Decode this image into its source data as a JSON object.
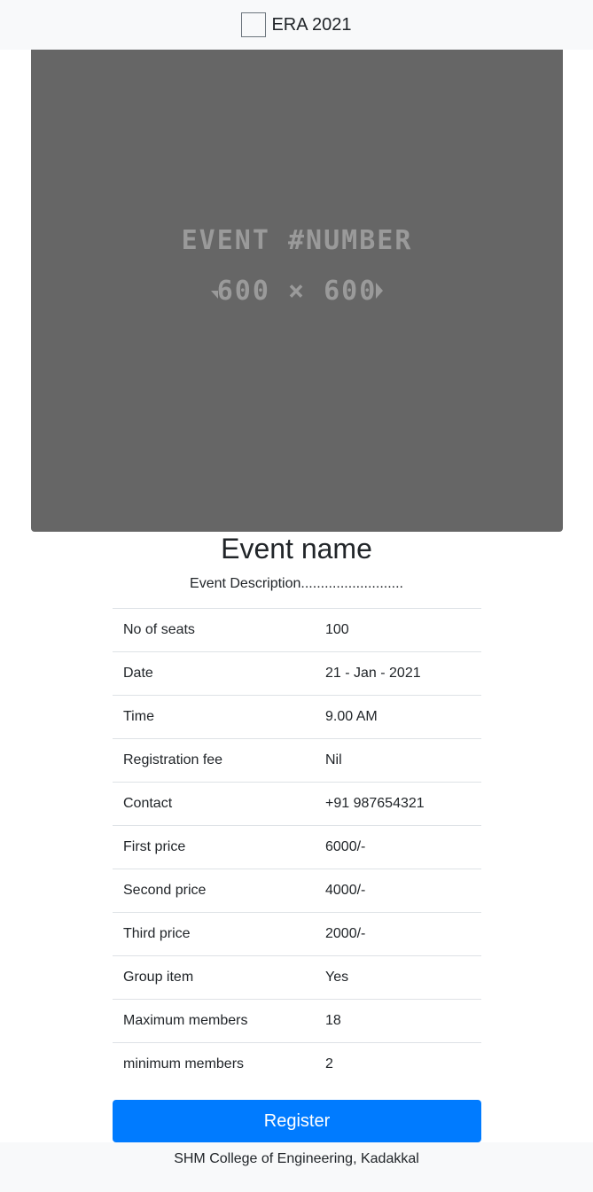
{
  "navbar": {
    "brand_text": "ERA 2021"
  },
  "poster": {
    "line1": "EVENT #NUMBER",
    "line2": "600 × 600",
    "background_color": "#666666",
    "text_color": "#9a9a9a"
  },
  "event": {
    "name": "Event name",
    "description": "Event Description.........................."
  },
  "details": [
    {
      "label": "No of seats",
      "value": "100"
    },
    {
      "label": "Date",
      "value": "21 - Jan - 2021"
    },
    {
      "label": "Time",
      "value": "9.00 AM"
    },
    {
      "label": "Registration fee",
      "value": "Nil"
    },
    {
      "label": "Contact",
      "value": "+91 987654321"
    },
    {
      "label": "First price",
      "value": "6000/-"
    },
    {
      "label": "Second price",
      "value": "4000/-"
    },
    {
      "label": "Third price",
      "value": "2000/-"
    },
    {
      "label": "Group item",
      "value": "Yes"
    },
    {
      "label": "Maximum members",
      "value": "18"
    },
    {
      "label": "minimum members",
      "value": "2"
    }
  ],
  "register_button": {
    "label": "Register",
    "color": "#007bff"
  },
  "footer": {
    "text": "SHM College of Engineering, Kadakkal"
  }
}
